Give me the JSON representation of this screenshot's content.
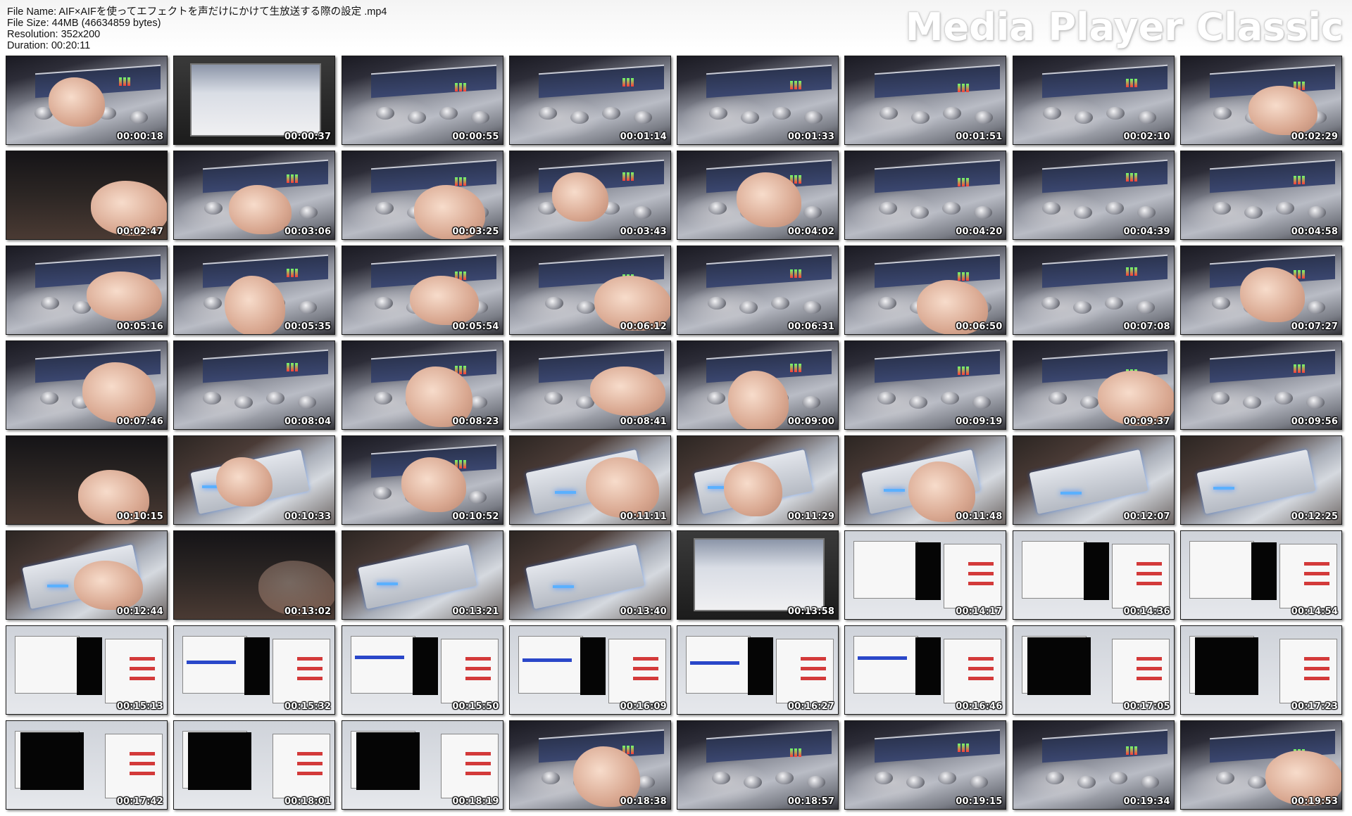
{
  "header": {
    "file_name": "File Name: AIF×AIFを使ってエフェクトを声だけにかけて生放送する際の設定 .mp4",
    "file_size": "File Size: 44MB (46634859 bytes)",
    "resolution": "Resolution: 352x200",
    "duration": "Duration: 00:20:11",
    "brand": "Media Player Classic"
  },
  "thumbnails": [
    {
      "time": "00:00:18",
      "scene": "device-hand"
    },
    {
      "time": "00:00:37",
      "scene": "crt"
    },
    {
      "time": "00:00:55",
      "scene": "device"
    },
    {
      "time": "00:01:14",
      "scene": "device"
    },
    {
      "time": "00:01:33",
      "scene": "device"
    },
    {
      "time": "00:01:51",
      "scene": "device"
    },
    {
      "time": "00:02:10",
      "scene": "device"
    },
    {
      "time": "00:02:29",
      "scene": "device-hand"
    },
    {
      "time": "00:02:47",
      "scene": "dark-hand"
    },
    {
      "time": "00:03:06",
      "scene": "device-hand"
    },
    {
      "time": "00:03:25",
      "scene": "device-hand"
    },
    {
      "time": "00:03:43",
      "scene": "device-hand"
    },
    {
      "time": "00:04:02",
      "scene": "device-hand"
    },
    {
      "time": "00:04:20",
      "scene": "device"
    },
    {
      "time": "00:04:39",
      "scene": "device"
    },
    {
      "time": "00:04:58",
      "scene": "device"
    },
    {
      "time": "00:05:16",
      "scene": "device-hand"
    },
    {
      "time": "00:05:35",
      "scene": "device-hand"
    },
    {
      "time": "00:05:54",
      "scene": "device-hand"
    },
    {
      "time": "00:06:12",
      "scene": "device-hand"
    },
    {
      "time": "00:06:31",
      "scene": "device"
    },
    {
      "time": "00:06:50",
      "scene": "device-hand"
    },
    {
      "time": "00:07:08",
      "scene": "device"
    },
    {
      "time": "00:07:27",
      "scene": "device-hand"
    },
    {
      "time": "00:07:46",
      "scene": "device-hand"
    },
    {
      "time": "00:08:04",
      "scene": "device"
    },
    {
      "time": "00:08:23",
      "scene": "device-hand"
    },
    {
      "time": "00:08:41",
      "scene": "device-hand"
    },
    {
      "time": "00:09:00",
      "scene": "device-hand"
    },
    {
      "time": "00:09:19",
      "scene": "device"
    },
    {
      "time": "00:09:37",
      "scene": "device-hand"
    },
    {
      "time": "00:09:56",
      "scene": "device"
    },
    {
      "time": "00:10:15",
      "scene": "dark-hand"
    },
    {
      "time": "00:10:33",
      "scene": "wavio-hand"
    },
    {
      "time": "00:10:52",
      "scene": "device-hand"
    },
    {
      "time": "00:11:11",
      "scene": "wavio-hand"
    },
    {
      "time": "00:11:29",
      "scene": "wavio-hand"
    },
    {
      "time": "00:11:48",
      "scene": "wavio-hand"
    },
    {
      "time": "00:12:07",
      "scene": "wavio"
    },
    {
      "time": "00:12:25",
      "scene": "wavio"
    },
    {
      "time": "00:12:44",
      "scene": "wavio-hand"
    },
    {
      "time": "00:13:02",
      "scene": "dark"
    },
    {
      "time": "00:13:21",
      "scene": "wavio"
    },
    {
      "time": "00:13:40",
      "scene": "wavio"
    },
    {
      "time": "00:13:58",
      "scene": "crt"
    },
    {
      "time": "00:14:17",
      "scene": "screen"
    },
    {
      "time": "00:14:36",
      "scene": "screen"
    },
    {
      "time": "00:14:54",
      "scene": "screen"
    },
    {
      "time": "00:15:13",
      "scene": "screen"
    },
    {
      "time": "00:15:32",
      "scene": "screen-blue"
    },
    {
      "time": "00:15:50",
      "scene": "screen-blue"
    },
    {
      "time": "00:16:09",
      "scene": "screen-blue"
    },
    {
      "time": "00:16:27",
      "scene": "screen-blue"
    },
    {
      "time": "00:16:46",
      "scene": "screen-blue"
    },
    {
      "time": "00:17:05",
      "scene": "screen-black"
    },
    {
      "time": "00:17:23",
      "scene": "screen-black"
    },
    {
      "time": "00:17:42",
      "scene": "screen-black"
    },
    {
      "time": "00:18:01",
      "scene": "screen-black"
    },
    {
      "time": "00:18:19",
      "scene": "screen-black"
    },
    {
      "time": "00:18:38",
      "scene": "device-hand"
    },
    {
      "time": "00:18:57",
      "scene": "device"
    },
    {
      "time": "00:19:15",
      "scene": "device"
    },
    {
      "time": "00:19:34",
      "scene": "device"
    },
    {
      "time": "00:19:53",
      "scene": "device-hand"
    }
  ]
}
